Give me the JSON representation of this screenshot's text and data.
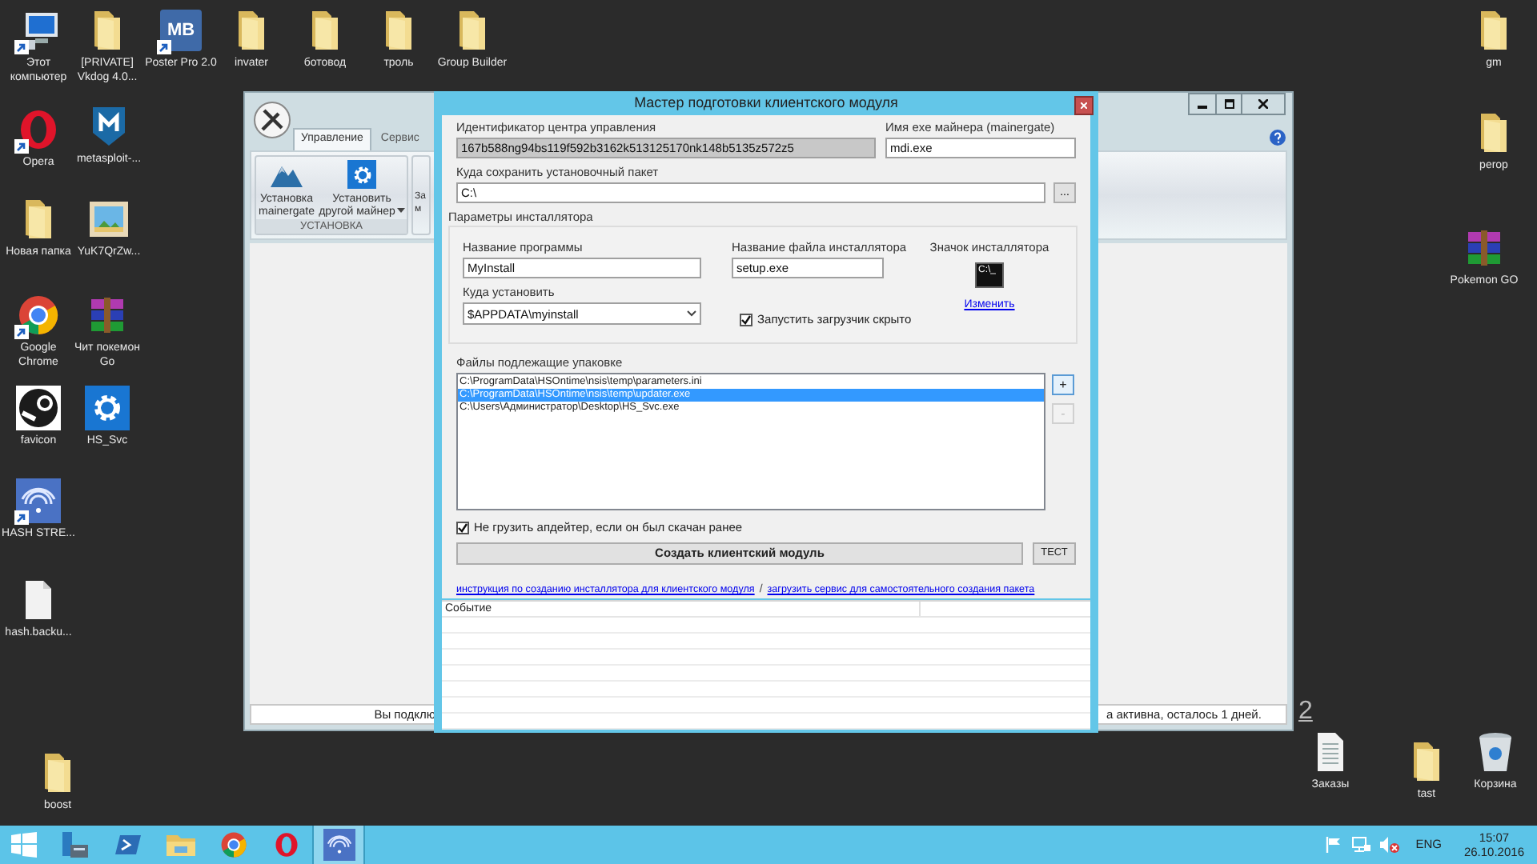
{
  "desktop_icons": [
    {
      "label": "Этот компьютер",
      "kind": "computer",
      "shortcut": true
    },
    {
      "label": "[PRIVATE] Vkdog 4.0...",
      "kind": "folder",
      "shortcut": false
    },
    {
      "label": "Poster Pro 2.0",
      "kind": "badge",
      "glyph": "MB",
      "shortcut": true
    },
    {
      "label": "invater",
      "kind": "folder",
      "shortcut": false
    },
    {
      "label": "ботовод",
      "kind": "folder",
      "shortcut": false
    },
    {
      "label": "троль",
      "kind": "folder",
      "shortcut": false
    },
    {
      "label": "Group Builder",
      "kind": "folder",
      "shortcut": false
    },
    {
      "label": "gm",
      "kind": "folder",
      "shortcut": false
    },
    {
      "label": "Opera",
      "kind": "opera",
      "shortcut": true
    },
    {
      "label": "metasploit-...",
      "kind": "shield",
      "shortcut": false
    },
    {
      "label": "perop",
      "kind": "folder",
      "shortcut": false
    },
    {
      "label": "Новая папка",
      "kind": "folder",
      "shortcut": false
    },
    {
      "label": "YuK7QrZw...",
      "kind": "image",
      "shortcut": false
    },
    {
      "label": "Pokemon GO",
      "kind": "archive",
      "shortcut": false
    },
    {
      "label": "Google Chrome",
      "kind": "chrome",
      "shortcut": true
    },
    {
      "label": "Чит покемон Go",
      "kind": "archive",
      "shortcut": false
    },
    {
      "label": "favicon",
      "kind": "steam",
      "shortcut": false
    },
    {
      "label": "HS_Svc",
      "kind": "gear",
      "shortcut": false
    },
    {
      "label": "HASH STRE...",
      "kind": "hash",
      "shortcut": true
    },
    {
      "label": "hash.backu...",
      "kind": "file",
      "shortcut": false
    },
    {
      "label": "boost",
      "kind": "folder",
      "shortcut": false
    },
    {
      "label": "Заказы",
      "kind": "textfile",
      "shortcut": false
    },
    {
      "label": "tast",
      "kind": "folder",
      "shortcut": false
    },
    {
      "label": "Корзина",
      "kind": "recycle",
      "shortcut": false
    }
  ],
  "app_window": {
    "tabs": [
      {
        "label": "Управление",
        "selected": true
      },
      {
        "label": "Сервис",
        "selected": false
      }
    ],
    "ribbon_buttons": [
      {
        "label": "Установка mainergate",
        "kind": "mountain",
        "dropdown": false
      },
      {
        "label": "Установить другой майнер",
        "kind": "gear",
        "dropdown": true
      }
    ],
    "group_label": "УСТАНОВКА",
    "hidden_button": "За м",
    "status_left": "Вы подклю",
    "status_right": "а активна, осталось 1 дней."
  },
  "stray_text": "2",
  "dialog": {
    "title": "Мастер подготовки клиентского модуля",
    "id_label": "Идентификатор центра управления",
    "id_value": "167b588ng94bs119f592b3162k513125170nk148b5135z572z5",
    "exe_label": "Имя exe майнера (mainergate)",
    "exe_value": "mdi.exe",
    "save_label": "Куда сохранить установочный пакет",
    "save_value": "C:\\",
    "browse_button": "...",
    "group_title": "Параметры инсталлятора",
    "program_label": "Название программы",
    "program_value": "MyInstall",
    "file_label": "Название файла инсталлятора",
    "file_value": "setup.exe",
    "icon_label": "Значок инсталлятора",
    "icon_glyph": "C:\\_",
    "change_link": "Изменить",
    "install_label": "Куда установить",
    "install_value": "$APPDATA\\myinstall",
    "hidden_checkbox": {
      "label": "Запустить загрузчик скрыто",
      "checked": true
    },
    "files_label": "Файлы подлежащие упаковке",
    "files": [
      {
        "path": "C:\\ProgramData\\HSOntime\\nsis\\temp\\parameters.ini",
        "selected": false
      },
      {
        "path": "C:\\ProgramData\\HSOntime\\nsis\\temp\\updater.exe",
        "selected": true
      },
      {
        "path": "C:\\Users\\Администратор\\Desktop\\HS_Svc.exe",
        "selected": false
      }
    ],
    "add_button": {
      "label": "+",
      "disabled": false
    },
    "remove_button": {
      "label": "-",
      "disabled": true
    },
    "updater_checkbox": {
      "label": "Не грузить апдейтер, если он был скачан ранее",
      "checked": true
    },
    "create_button": "Создать клиентский модуль",
    "test_button": "ТЕСТ",
    "links": [
      "инструкция по созданию инсталлятора для клиентского модуля",
      "загрузить сервис для самостоятельного создания пакета"
    ],
    "link_separator": "/",
    "event_table": {
      "columns": [
        "Событие"
      ]
    }
  },
  "taskbar": {
    "apps": [
      {
        "kind": "start",
        "selected": false
      },
      {
        "kind": "server",
        "selected": false
      },
      {
        "kind": "powershell",
        "selected": false
      },
      {
        "kind": "explorer",
        "selected": false
      },
      {
        "kind": "chrome",
        "selected": false
      },
      {
        "kind": "opera",
        "selected": false
      },
      {
        "kind": "hash",
        "selected": true
      }
    ],
    "language": "ENG",
    "time": "15:07",
    "date": "26.10.2016"
  }
}
